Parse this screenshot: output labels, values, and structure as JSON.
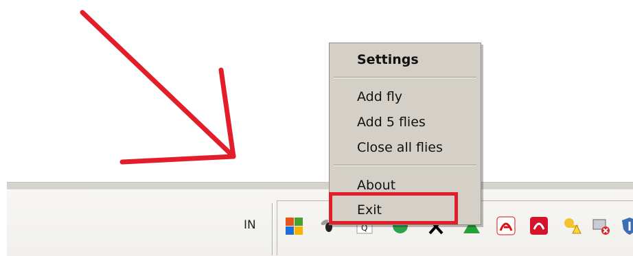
{
  "context_menu": {
    "items": [
      {
        "label": "Settings",
        "bold": true
      },
      {
        "label": "Add fly"
      },
      {
        "label": "Add 5 flies"
      },
      {
        "label": "Close all flies"
      },
      {
        "label": "About"
      },
      {
        "label": "Exit"
      }
    ]
  },
  "taskbar": {
    "language": "IN",
    "tray_icons": [
      "multicolor-squares-icon",
      "fly-icon",
      "q-document-icon",
      "green-globe-icon",
      "x-icon",
      "green-triangle-icon",
      "avira-umbrella-icon",
      "red-swirl-icon",
      "keys-warning-icon",
      "network-disconnected-icon",
      "shield-icon"
    ]
  },
  "colors": {
    "annotation_red": "#e21e2a",
    "menu_background": "#d4d0c8",
    "taskbar_background": "#f1f0ec"
  }
}
